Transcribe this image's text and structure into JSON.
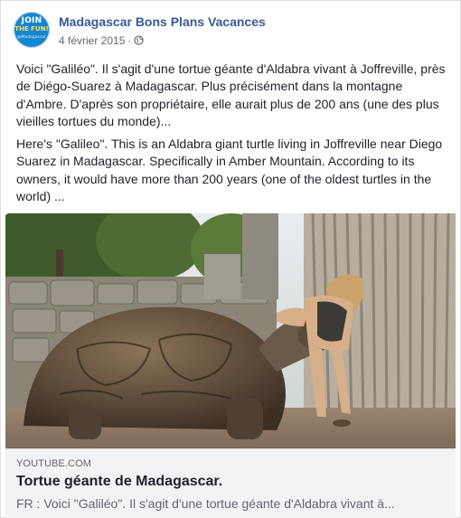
{
  "post": {
    "page_name": "Madagascar Bons Plans Vacances",
    "date": "4 février 2015",
    "separator": "·",
    "privacy_icon": "globe-icon",
    "avatar": {
      "line1": "JOIN",
      "line2": "THE FUN!",
      "line3": "@Madagascar"
    },
    "text_fr": "Voici \"Galiléo\". Il s'agit d'une tortue géante d'Aldabra vivant à Joffreville, près de Diégo-Suarez à Madagascar. Plus précisément dans la montagne d'Ambre. D'après son propriétaire, elle aurait plus de 200 ans (une des plus vieilles tortues du monde)...",
    "text_en": "Here's \"Galileo\". This is an Aldabra giant turtle living in Joffreville near Diego Suarez in Madagascar. Specifically in Amber Mountain. According to its owners, it would have more than 200 years (one of the oldest turtles in the world) ..."
  },
  "link_preview": {
    "domain": "YOUTUBE.COM",
    "title": "Tortue géante de Madagascar.",
    "description": "FR : Voici \"Galiléo\". Il s'agit d'une tortue géante d'Aldabra vivant à..."
  },
  "colors": {
    "page_name": "#385898",
    "meta_text": "#616770",
    "link_box_bg": "#f2f3f5",
    "avatar_bg": "#1685d3"
  }
}
